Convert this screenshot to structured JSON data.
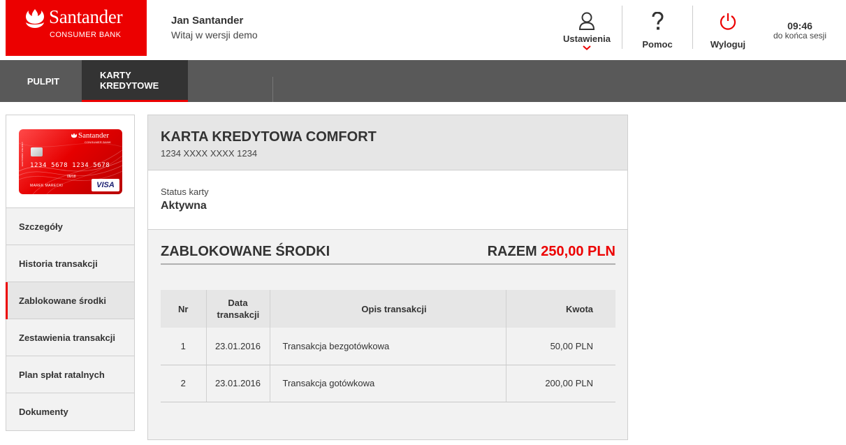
{
  "brand": {
    "name": "Santander",
    "subtitle": "CONSUMER BANK",
    "color": "#ec0000"
  },
  "user": {
    "name": "Jan Santander",
    "greeting": "Witaj w wersji demo"
  },
  "header": {
    "settings_label": "Ustawienia",
    "help_label": "Pomoc",
    "logout_label": "Wyloguj",
    "session_time": "09:46",
    "session_label": "do końca sesji"
  },
  "nav": {
    "tabs": [
      {
        "label": "PULPIT"
      },
      {
        "label": "KARTY KREDYTOWE"
      }
    ]
  },
  "card_image": {
    "brand": "Santander",
    "sub": "CONSUMER BANK",
    "number": "1234 5678 1234 5678",
    "expiry": "06/18",
    "holder": "MAREK MARECKI",
    "network": "VISA",
    "side_text": "ELECTRONIC USE ONLY"
  },
  "sidebar": {
    "items": [
      {
        "label": "Szczegóły"
      },
      {
        "label": "Historia transakcji"
      },
      {
        "label": "Zablokowane środki"
      },
      {
        "label": "Zestawienia transakcji"
      },
      {
        "label": "Plan spłat ratalnych"
      },
      {
        "label": "Dokumenty"
      }
    ],
    "active_index": 2
  },
  "card": {
    "title": "KARTA KREDYTOWA COMFORT",
    "number": "1234 XXXX XXXX 1234",
    "status_label": "Status karty",
    "status_value": "Aktywna"
  },
  "blocked": {
    "title": "ZABLOKOWANE ŚRODKI",
    "total_label": "RAZEM",
    "total_amount": "250,00 PLN",
    "columns": {
      "nr": "Nr",
      "date": "Data transakcji",
      "desc": "Opis transakcji",
      "amount": "Kwota"
    },
    "rows": [
      {
        "nr": "1",
        "date": "23.01.2016",
        "desc": "Transakcja bezgotówkowa",
        "amount": "50,00 PLN"
      },
      {
        "nr": "2",
        "date": "23.01.2016",
        "desc": "Transakcja gotówkowa",
        "amount": "200,00 PLN"
      }
    ]
  }
}
